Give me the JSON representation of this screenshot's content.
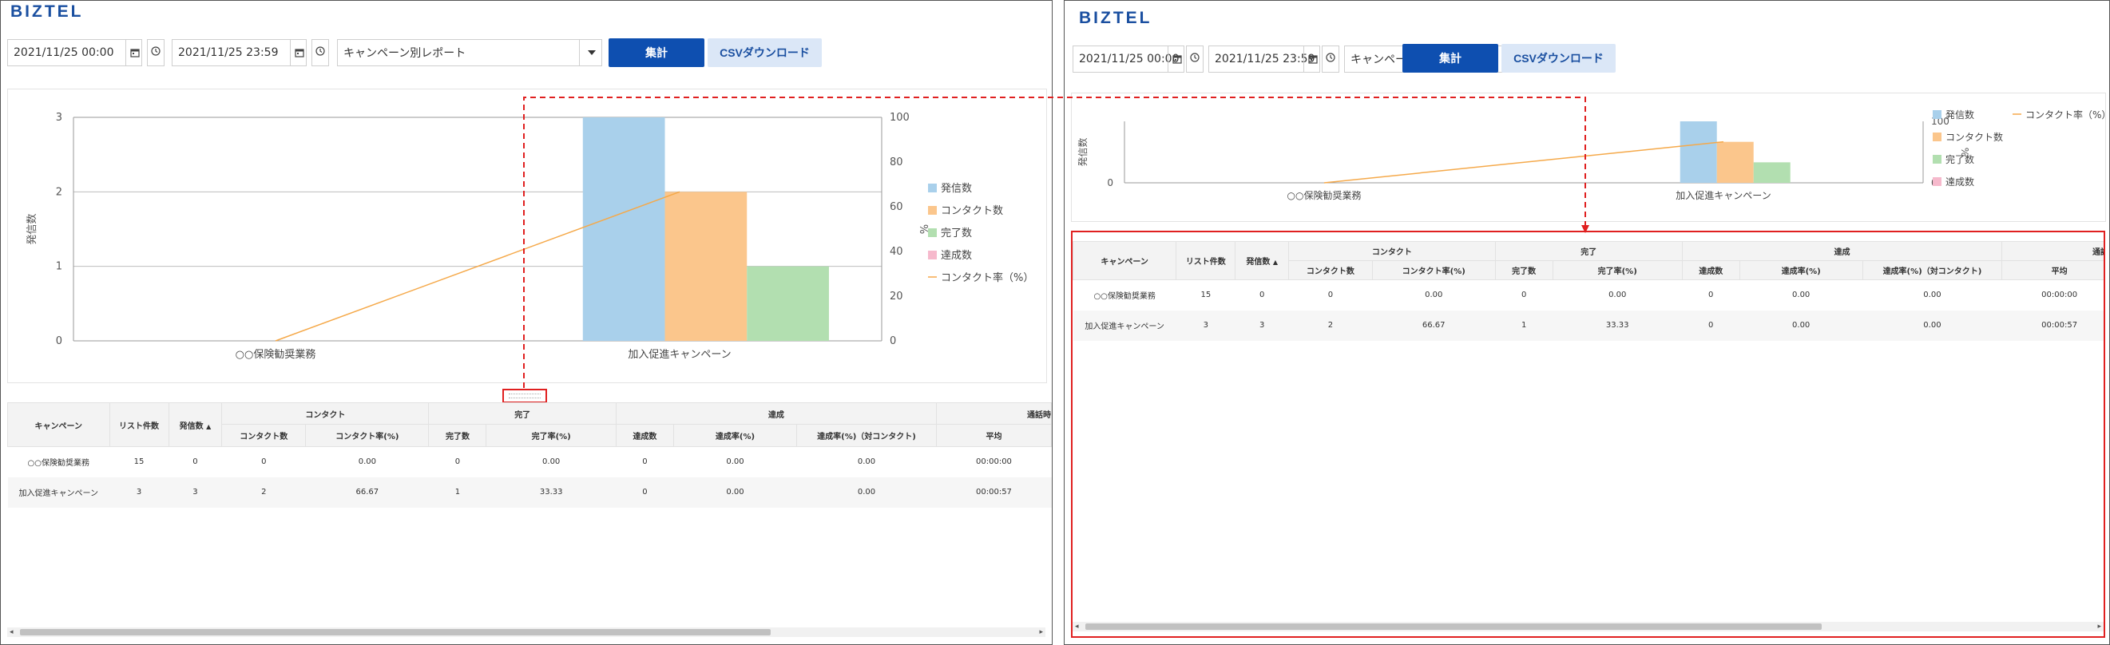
{
  "app": {
    "logo": "BIZTEL"
  },
  "filters": {
    "start_datetime": "2021/11/25 00:00",
    "end_datetime": "2021/11/25 23:59",
    "report_type": "キャンペーン別レポート",
    "aggregate_label": "集計",
    "csv_label": "CSVダウンロード"
  },
  "chart_data": {
    "type": "bar",
    "categories": [
      "○○保険勧奨業務",
      "加入促進キャンペーン"
    ],
    "series": [
      {
        "name": "発信数",
        "values": [
          0,
          3
        ],
        "color": "#a9d0eb"
      },
      {
        "name": "コンタクト数",
        "values": [
          0,
          2
        ],
        "color": "#fbc68c"
      },
      {
        "name": "完了数",
        "values": [
          0,
          1
        ],
        "color": "#b2dfb0"
      },
      {
        "name": "達成数",
        "values": [
          0,
          0
        ],
        "color": "#f6b9cc"
      }
    ],
    "line_series": {
      "name": "コンタクト率（%）",
      "values": [
        0,
        66.67
      ],
      "color": "#f5a94a"
    },
    "ylabel": "発信数",
    "y2label": "%",
    "ylim": [
      0,
      3
    ],
    "y2lim": [
      0,
      100
    ],
    "yticks": [
      "0",
      "1",
      "2",
      "3"
    ],
    "y2ticks": [
      "0",
      "20",
      "40",
      "60",
      "80",
      "100"
    ],
    "compact_yticks": [
      "0"
    ],
    "compact_y2ticks": [
      "0",
      "100"
    ],
    "legend_position": "right",
    "grid": true
  },
  "table": {
    "group_headers": {
      "campaign": "キャンペーン",
      "list_count": "リスト件数",
      "calls": "発信数",
      "contact": "コンタクト",
      "complete": "完了",
      "achieve": "達成",
      "talk_time": "通話時"
    },
    "sort_indicator": "▲",
    "sub_headers": [
      "コンタクト数",
      "コンタクト率(%)",
      "完了数",
      "完了率(%)",
      "達成数",
      "達成率(%)",
      "達成率(%)（対コンタクト)",
      "平均"
    ],
    "rows": [
      [
        "○○保険勧奨業務",
        "15",
        "0",
        "0",
        "0.00",
        "0",
        "0.00",
        "0",
        "0.00",
        "0.00",
        "00:00:00"
      ],
      [
        "加入促進キャンペーン",
        "3",
        "3",
        "2",
        "66.67",
        "1",
        "33.33",
        "0",
        "0.00",
        "0.00",
        "00:00:57"
      ]
    ]
  },
  "colors": {
    "accent": "#0e4fb0",
    "highlight": "#e02020"
  },
  "icons": [
    "calendar-icon",
    "clock-icon",
    "chevron-down-icon",
    "drag-handle-icon"
  ]
}
